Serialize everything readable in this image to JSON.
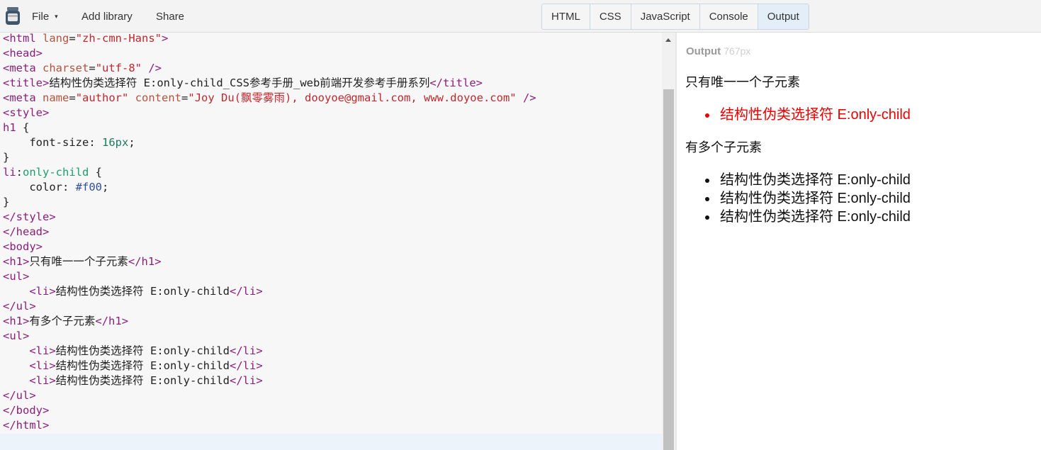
{
  "toolbar": {
    "logo_icon": "jar-icon",
    "file_label": "File",
    "file_caret": "▾",
    "add_library_label": "Add library",
    "share_label": "Share"
  },
  "tabs": [
    {
      "label": "HTML",
      "active": false
    },
    {
      "label": "CSS",
      "active": false
    },
    {
      "label": "JavaScript",
      "active": false
    },
    {
      "label": "Console",
      "active": false
    },
    {
      "label": "Output",
      "active": true
    }
  ],
  "editor": {
    "lines": [
      "<html lang=\"zh-cmn-Hans\">",
      "<head>",
      "<meta charset=\"utf-8\" />",
      "<title>结构性伪类选择符 E:only-child_CSS参考手册_web前端开发参考手册系列</title>",
      "<meta name=\"author\" content=\"Joy Du(飘零雾雨), dooyoe@gmail.com, www.doyoe.com\" />",
      "<style>",
      "h1 {",
      "    font-size: 16px;",
      "}",
      "li:only-child {",
      "    color: #f00;",
      "}",
      "</style>",
      "</head>",
      "<body>",
      "<h1>只有唯一一个子元素</h1>",
      "<ul>",
      "    <li>结构性伪类选择符 E:only-child</li>",
      "</ul>",
      "<h1>有多个子元素</h1>",
      "<ul>",
      "    <li>结构性伪类选择符 E:only-child</li>",
      "    <li>结构性伪类选择符 E:only-child</li>",
      "    <li>结构性伪类选择符 E:only-child</li>",
      "</ul>",
      "</body>",
      "</html>"
    ]
  },
  "output": {
    "label": "Output",
    "width_text": "767px",
    "heading1": "只有唯一一个子元素",
    "list1": [
      "结构性伪类选择符 E:only-child"
    ],
    "heading2": "有多个子元素",
    "list2": [
      "结构性伪类选择符 E:only-child",
      "结构性伪类选择符 E:only-child",
      "结构性伪类选择符 E:only-child"
    ],
    "only_child_color": "#ee0000"
  },
  "colors": {
    "tag": "#8b1e7a",
    "attr_name": "#b5533c",
    "attr_value": "#c1272d",
    "pseudo": "#1e9e6a",
    "active_tab": "#e3eef8"
  }
}
